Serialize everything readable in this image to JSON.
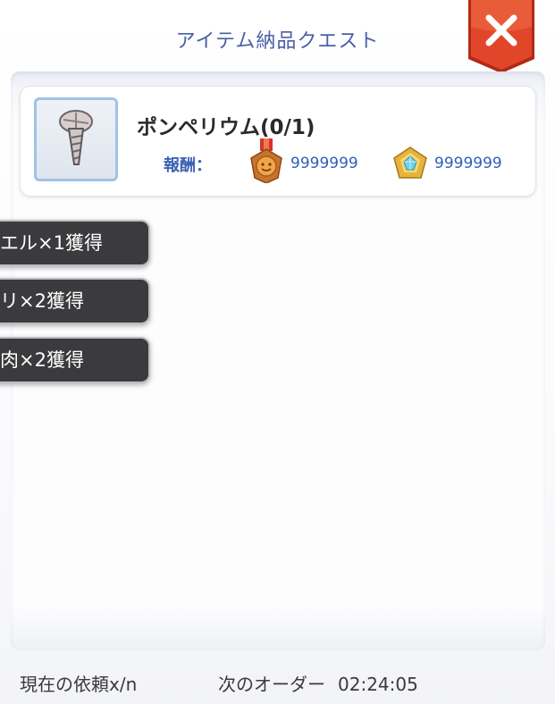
{
  "header": {
    "title": "アイテム納品クエスト"
  },
  "item": {
    "name": "ポンペリウム(0/1)",
    "reward_label": "報酬：",
    "reward_medal_value": "9999999",
    "reward_crystal_value": "9999999",
    "item_icon": "nail-icon",
    "medal_icon": "medal-icon",
    "crystal_icon": "crystal-icon"
  },
  "toasts": [
    "エル×1獲得",
    "リ×2獲得",
    "肉×2獲得"
  ],
  "footer": {
    "current_request": "現在の依頼x/n",
    "next_order_label": "次のオーダー",
    "next_order_time": "02:24:05"
  },
  "colors": {
    "title": "#4a5fa6",
    "close_button": "#d93d22",
    "reward_text": "#2f5fbd",
    "toast_bg": "#3b3b3e"
  }
}
